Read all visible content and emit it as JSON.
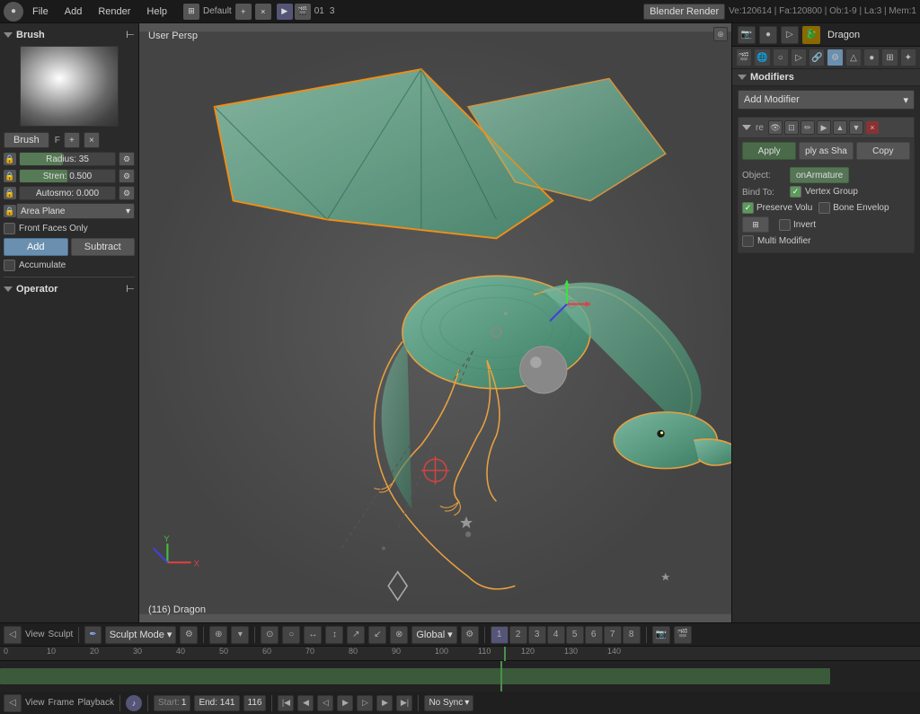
{
  "topbar": {
    "engine": "Blender Render",
    "info_text": "Ve:120614 | Fa:120800 | Ob:1-9 | La:3 | Mem:1",
    "scene": "01",
    "menus": [
      "File",
      "Add",
      "Render",
      "Help"
    ]
  },
  "left_panel": {
    "title": "Brush",
    "radius_label": "Radius: 35",
    "strength_label": "Stren: 0.500",
    "autosmooth_label": "Autosmo: 0.000",
    "mode_label": "Area Plane",
    "front_faces_label": "Front Faces Only",
    "add_label": "Add",
    "subtract_label": "Subtract",
    "accumulate_label": "Accumulate",
    "operator_label": "Operator"
  },
  "viewport": {
    "perspective": "User Persp",
    "object_label": "(116) Dragon"
  },
  "right_panel": {
    "object_name": "Dragon",
    "modifiers_title": "Modifiers",
    "add_modifier_label": "Add Modifier",
    "apply_label": "Apply",
    "ply_as_sha_label": "ply as Sha",
    "copy_label": "Copy",
    "object_label": "Object:",
    "bind_to_label": "Bind To:",
    "armature_btn": "onArmature",
    "vertex_group_label": "Vertex Group",
    "preserve_vol_label": "Preserve Volu",
    "bone_envelop_label": "Bone Envelop",
    "invert_label": "Invert",
    "multi_modifier_label": "Multi Modifier"
  },
  "bottom_toolbar": {
    "mode": "Sculpt Mode",
    "global": "Global"
  },
  "timeline": {
    "start_label": "Start:",
    "start_value": "1",
    "end_label": "End: 141",
    "current_frame": "116",
    "sync_label": "No Sync",
    "markers": [
      0,
      10,
      20,
      30,
      40,
      50,
      60,
      70,
      80,
      90,
      100,
      110,
      120,
      130,
      140
    ]
  },
  "playback": {
    "view_label": "View",
    "frame_label": "Frame",
    "playback_label": "Playback"
  }
}
